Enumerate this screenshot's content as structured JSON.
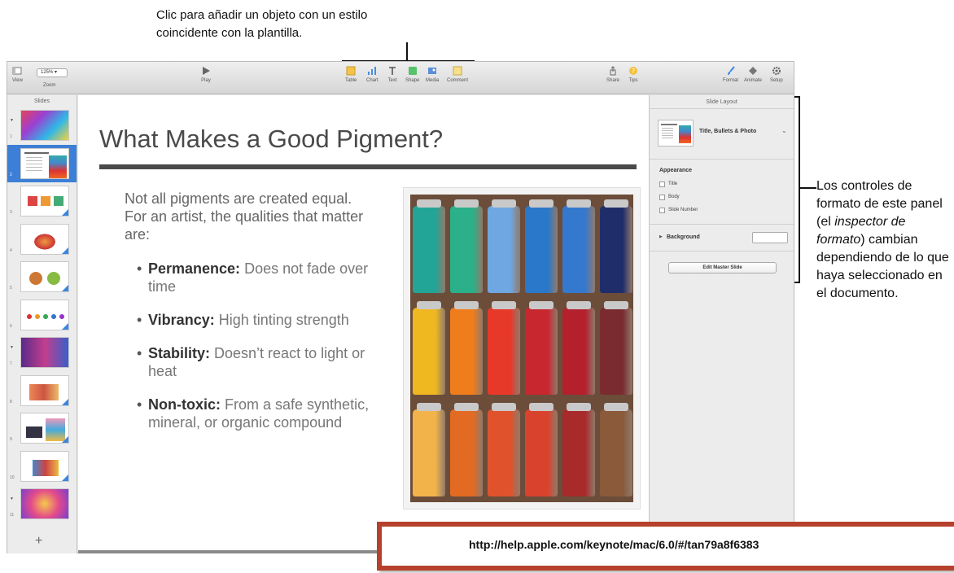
{
  "annotations": {
    "top_callout": "Clic para añadir un objeto con un estilo coincidente con la plantilla.",
    "right_callout_1": "Los controles de formato de este panel (el ",
    "right_callout_italic_1": "inspector de formato",
    "right_callout_2": ") cambian dependiendo de lo que haya seleccionado en el documento."
  },
  "toolbar": {
    "view": "View",
    "zoom_value": "125% ▾",
    "zoom": "Zoom",
    "play": "Play",
    "table": "Table",
    "chart": "Chart",
    "text": "Text",
    "shape": "Shape",
    "media": "Media",
    "comment": "Comment",
    "share": "Share",
    "tips": "Tips",
    "format": "Format",
    "animate": "Animate",
    "setup": "Setup"
  },
  "slides_panel": {
    "title": "Slides",
    "add": "+",
    "numbers": [
      "1",
      "2",
      "3",
      "4",
      "5",
      "6",
      "7",
      "8",
      "9",
      "10",
      "11"
    ]
  },
  "slide": {
    "title": "What Makes a Good Pigment?",
    "intro": "Not all pigments are created equal. For an artist, the qualities that matter are:",
    "bullets": [
      {
        "term": "Permanence:",
        "text": " Does not fade over time"
      },
      {
        "term": "Vibrancy:",
        "text": " High tinting strength"
      },
      {
        "term": "Stability:",
        "text": " Doesn’t react to light or heat"
      },
      {
        "term": "Non-toxic:",
        "text": " From a safe synthetic, mineral, or organic compound"
      }
    ]
  },
  "inspector": {
    "header": "Slide Layout",
    "layout_name": "Title, Bullets & Photo",
    "appearance_title": "Appearance",
    "checkbox_title": "Title",
    "checkbox_body": "Body",
    "checkbox_slide_number": "Slide Number",
    "background": "Background",
    "edit_master": "Edit Master Slide"
  },
  "url": "http://help.apple.com/keynote/mac/6.0/#/tan79a8f6383",
  "colors": {
    "selection": "#3d7fd6",
    "banner_border": "#b5412c",
    "accent_blue": "#3a86e0"
  }
}
